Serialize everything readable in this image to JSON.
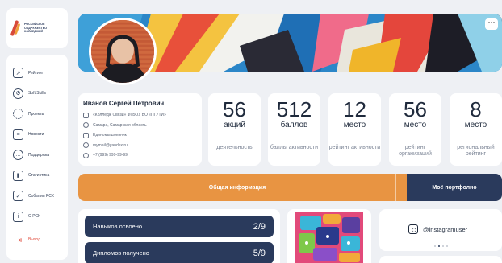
{
  "logo": {
    "text": "РОССИЙСКОЕ СОДРУЖЕСТВО КОЛЛЕДЖЕЙ",
    "icon": "rsk-logo"
  },
  "sidebar": {
    "items": [
      {
        "label": "Рейтинг",
        "icon": "chart-line-icon"
      },
      {
        "label": "Soft Skills",
        "icon": "gear-icon"
      },
      {
        "label": "Проекты",
        "icon": "spinner-icon"
      },
      {
        "label": "Новости",
        "icon": "document-icon"
      },
      {
        "label": "Поддержка",
        "icon": "chat-icon"
      },
      {
        "label": "Статистика",
        "icon": "bar-chart-icon"
      },
      {
        "label": "События РСК",
        "icon": "calendar-check-icon"
      },
      {
        "label": "О РСК",
        "icon": "info-icon"
      }
    ],
    "logout": {
      "label": "Выход",
      "icon": "logout-icon"
    }
  },
  "banner": {
    "menu_glyph": "···"
  },
  "profile": {
    "name": "Иванов Сергей Петрович",
    "college": "«Колледж Связи» ФГБОУ ВО «ПГУТИ»",
    "city": "Самара, Самарская область",
    "specialty": "Единомышленник",
    "email": "mymail@yandex.ru",
    "phone": "+7 (999) 999-99-99"
  },
  "stats": [
    {
      "value": "56",
      "unit": "акций",
      "desc": "деятельность"
    },
    {
      "value": "512",
      "unit": "баллов",
      "desc": "баллы активности"
    },
    {
      "value": "12",
      "unit": "место",
      "desc": "рейтинг активности"
    },
    {
      "value": "56",
      "unit": "место",
      "desc": "рейтинг организаций"
    },
    {
      "value": "8",
      "unit": "место",
      "desc": "региональный рейтинг"
    }
  ],
  "tabs": {
    "general": "Общая информация",
    "portfolio": "Моё портфолио"
  },
  "skills": [
    {
      "label": "Навыков освоено",
      "value": "2/9"
    },
    {
      "label": "Дипломов получено",
      "value": "5/9"
    }
  ],
  "instagram": {
    "handle": "@instagramuser"
  },
  "colors": {
    "accent_orange": "#e89442",
    "navy": "#2a3a5c",
    "logout_red": "#e04b3c",
    "background": "#eef0f4"
  }
}
